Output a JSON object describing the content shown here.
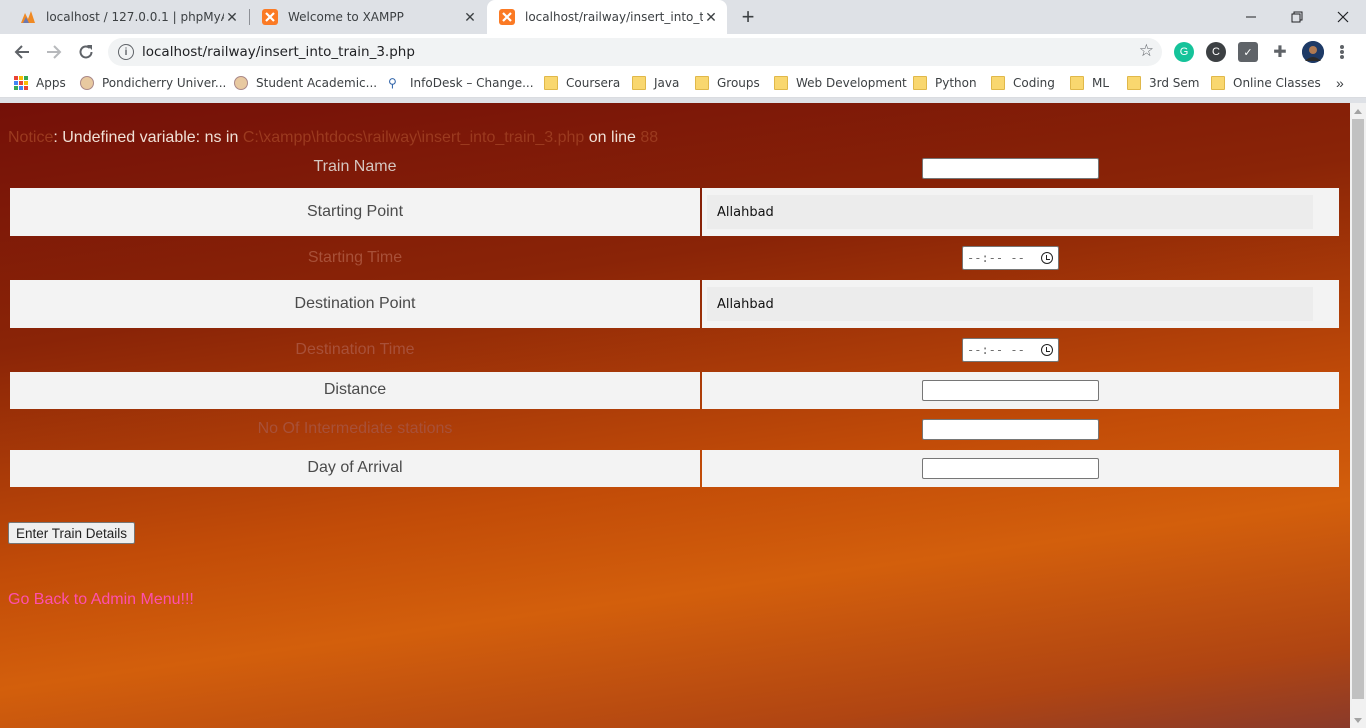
{
  "browser": {
    "tabs": [
      {
        "title": "localhost / 127.0.0.1 | phpMyAdmin",
        "icon": "phpmyadmin-icon",
        "active": false
      },
      {
        "title": "Welcome to XAMPP",
        "icon": "xampp-icon",
        "active": false
      },
      {
        "title": "localhost/railway/insert_into_train_3.php",
        "icon": "xampp-icon",
        "active": true
      }
    ],
    "url": "localhost/railway/insert_into_train_3.php",
    "bookmarks": [
      {
        "label": "Apps",
        "icon": "apps-grid-icon"
      },
      {
        "label": "Pondicherry Univer...",
        "icon": "university-logo-icon"
      },
      {
        "label": "Student Academic...",
        "icon": "university-logo-icon"
      },
      {
        "label": "InfoDesk – Change...",
        "icon": "infodesk-icon"
      },
      {
        "label": "Coursera",
        "icon": "folder-icon"
      },
      {
        "label": "Java",
        "icon": "folder-icon"
      },
      {
        "label": "Groups",
        "icon": "folder-icon"
      },
      {
        "label": "Web Development",
        "icon": "folder-icon"
      },
      {
        "label": "Python",
        "icon": "folder-icon"
      },
      {
        "label": "Coding",
        "icon": "folder-icon"
      },
      {
        "label": "ML",
        "icon": "folder-icon"
      },
      {
        "label": "3rd Sem",
        "icon": "folder-icon"
      },
      {
        "label": "Online Classes",
        "icon": "folder-icon"
      }
    ]
  },
  "notice": {
    "prefix": "Notice",
    "message": ": Undefined variable: ns in ",
    "path": "C:\\xampp\\htdocs\\railway\\insert_into_train_3.php",
    "on_line": " on line ",
    "line": "88"
  },
  "form": {
    "train_name": {
      "label": "Train Name",
      "value": ""
    },
    "starting_point": {
      "label": "Starting Point",
      "value": "Allahbad"
    },
    "starting_time": {
      "label": "Starting Time",
      "value": "--:-- --"
    },
    "destination_point": {
      "label": "Destination Point",
      "value": "Allahbad"
    },
    "destination_time": {
      "label": "Destination Time",
      "value": "--:-- --"
    },
    "distance": {
      "label": "Distance",
      "value": ""
    },
    "intermediate_stations": {
      "label": "No Of Intermediate stations",
      "value": ""
    },
    "day_of_arrival": {
      "label": "Day of Arrival",
      "value": ""
    },
    "submit_label": "Enter Train Details"
  },
  "back_link": "Go Back to Admin Menu!!!"
}
